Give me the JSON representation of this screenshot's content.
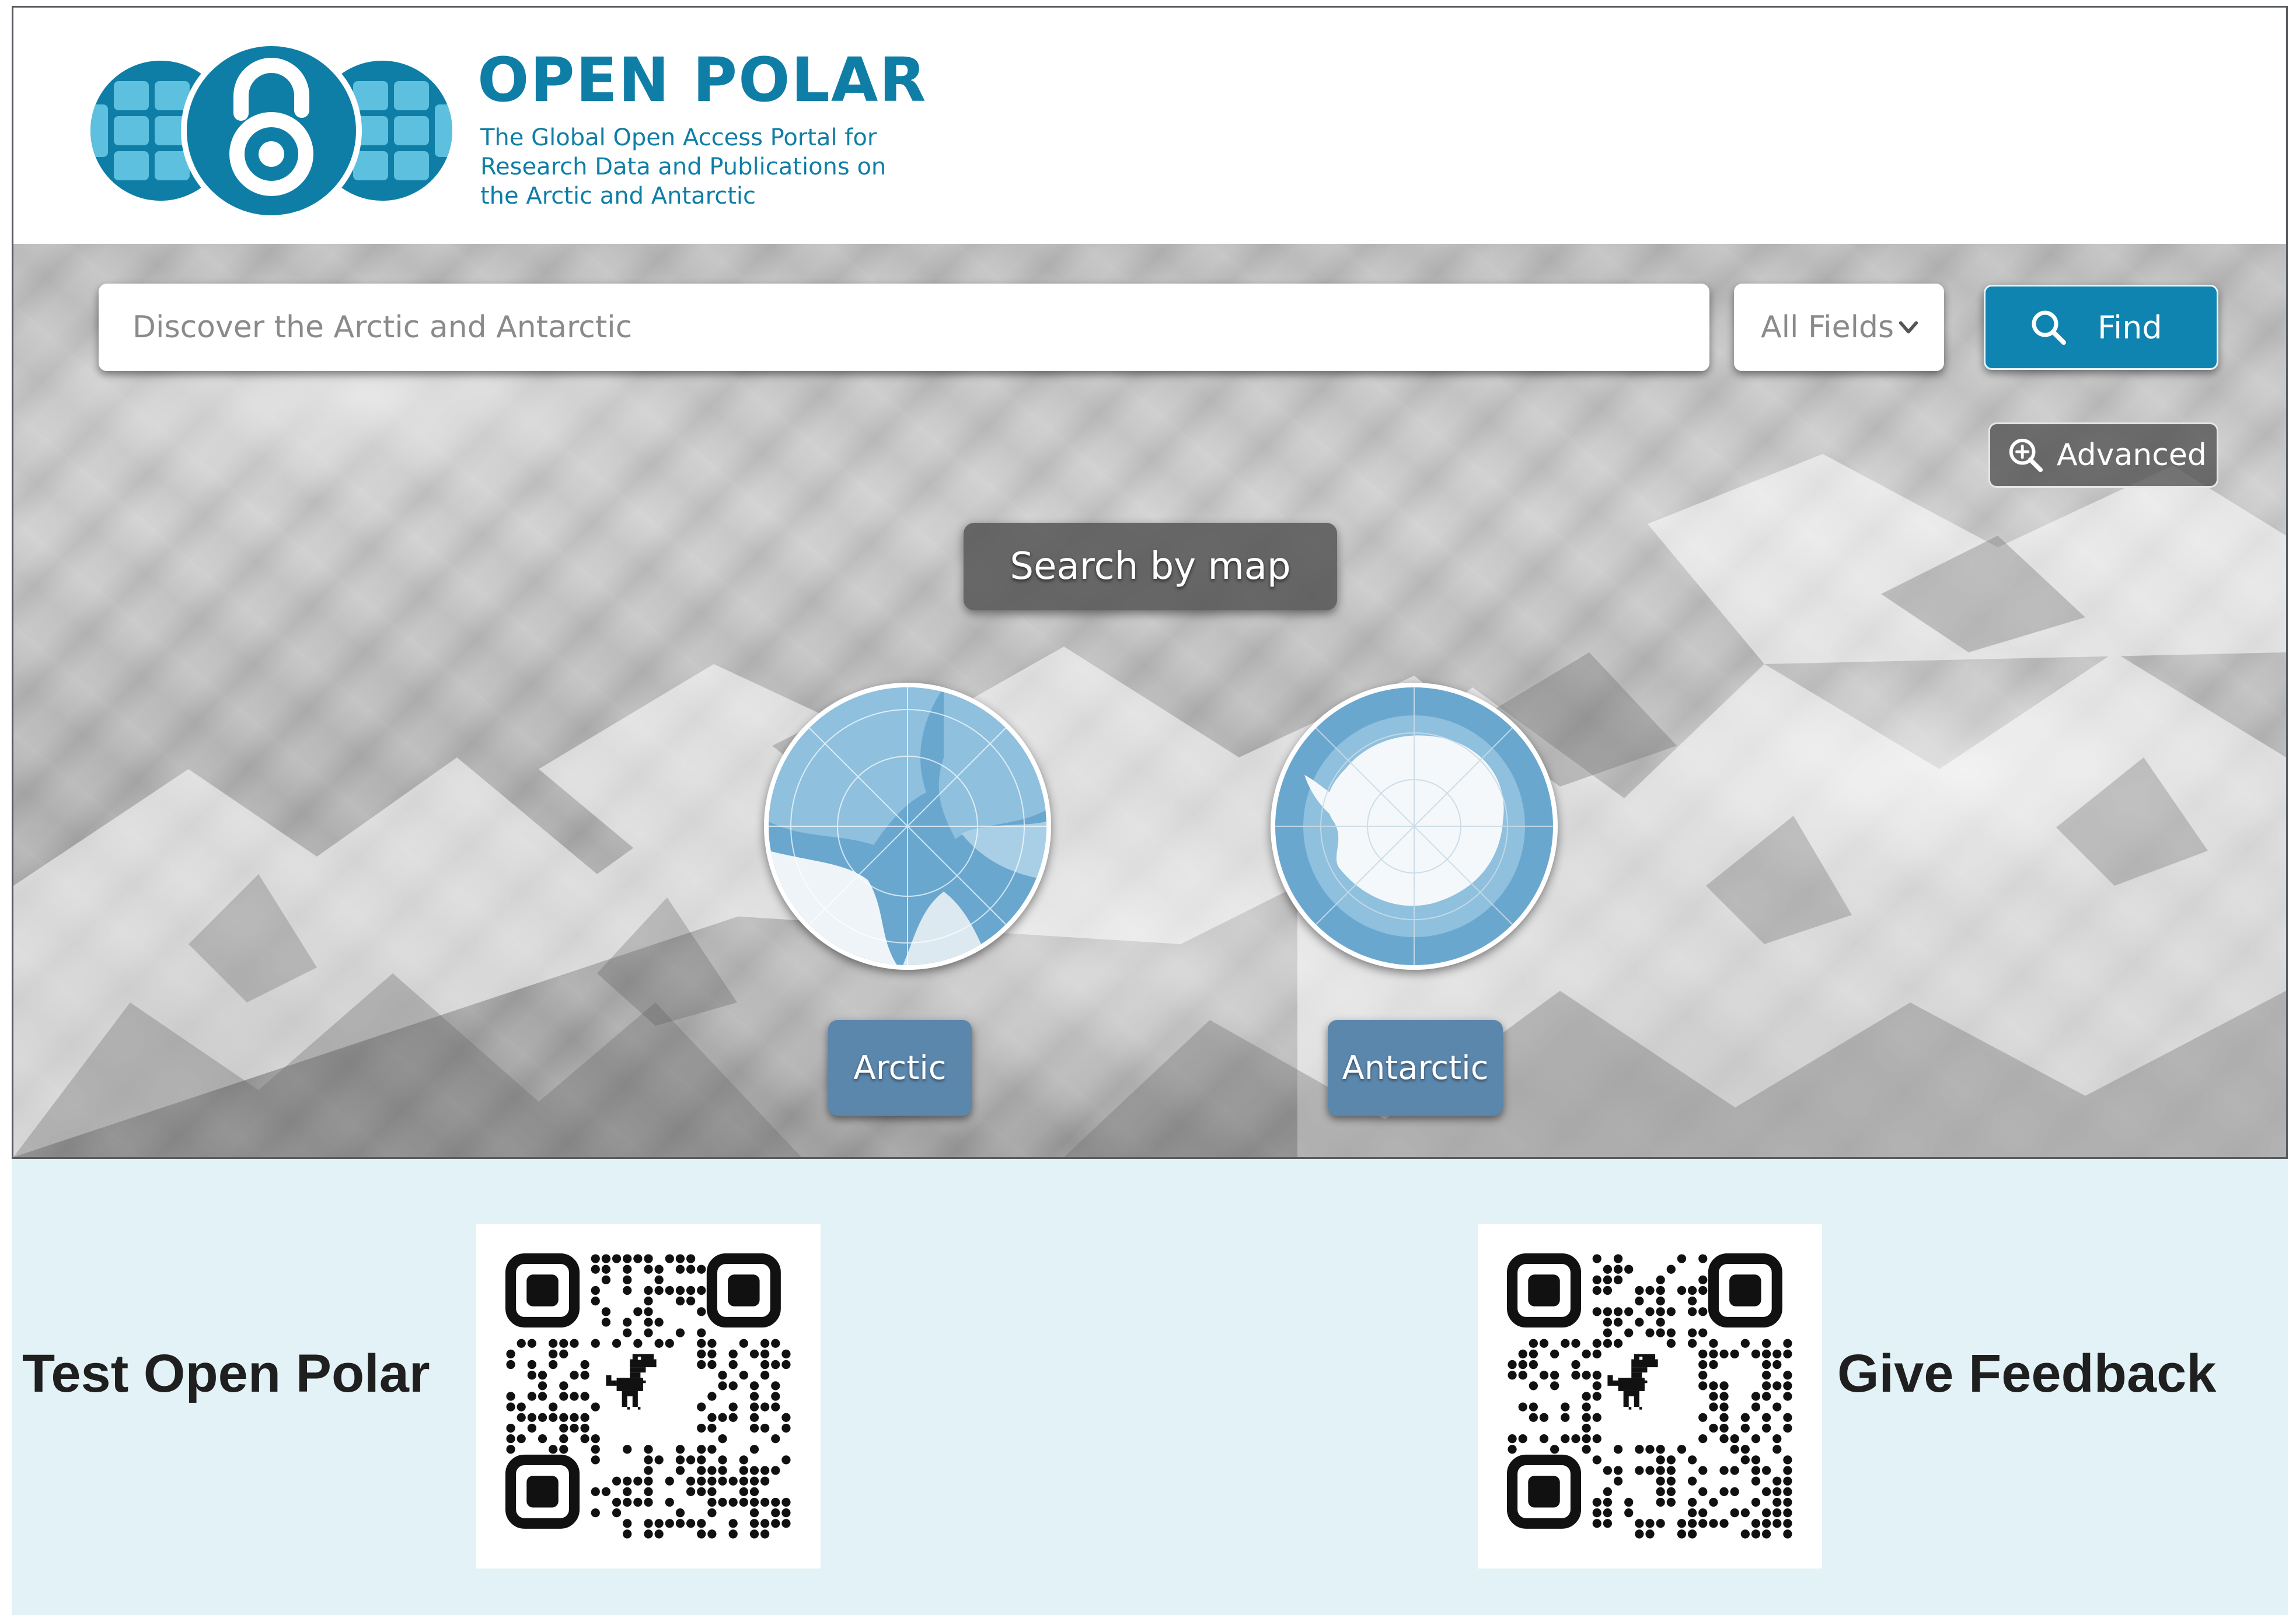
{
  "brand": {
    "title": "OPEN POLAR",
    "tagline_lines": [
      "The Global Open Access Portal for",
      "Research Data and Publications on",
      "the Arctic and Antarctic"
    ],
    "logo_icon": "open-access-globe-logo"
  },
  "search": {
    "placeholder": "Discover the Arctic and Antarctic",
    "field_select": {
      "selected": "All Fields",
      "icon": "chevron-down-icon"
    },
    "find_label": "Find",
    "find_icon": "search-icon",
    "advanced_label": "Advanced",
    "advanced_icon": "zoom-plus-icon"
  },
  "map_search": {
    "heading": "Search by map",
    "regions": [
      {
        "label": "Arctic",
        "icon": "arctic-polar-map"
      },
      {
        "label": "Antarctic",
        "icon": "antarctic-polar-map"
      }
    ]
  },
  "promo": {
    "test_label": "Test Open Polar",
    "feedback_label": "Give Feedback",
    "qr_icon": "qr-code-dino"
  },
  "colors": {
    "brand_blue": "#0f7ea6",
    "find_button": "#0f84b0",
    "region_button": "#5b87ad",
    "promo_background": "#e3f2f6",
    "map_ocean": "#6aa7cf"
  }
}
